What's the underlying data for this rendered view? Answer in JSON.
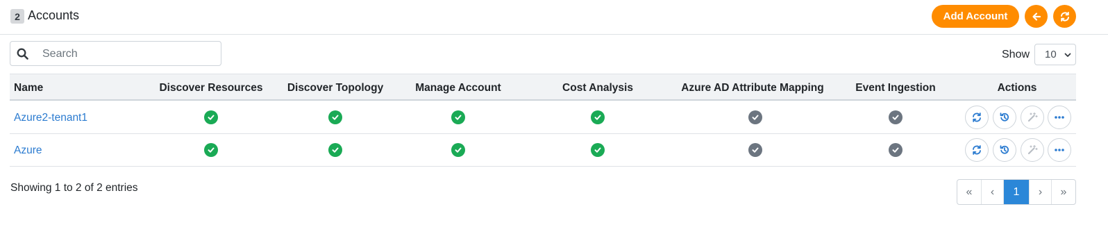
{
  "header": {
    "count": "2",
    "title": "Accounts",
    "add_label": "Add Account",
    "accent_color": "#ff8c00",
    "back_icon": "arrow-left-icon",
    "refresh_icon": "refresh-icon"
  },
  "search": {
    "placeholder": "Search",
    "value": ""
  },
  "show": {
    "label": "Show",
    "value": "10"
  },
  "table": {
    "columns": [
      "Name",
      "Discover Resources",
      "Discover Topology",
      "Manage Account",
      "Cost Analysis",
      "Azure AD Attribute Mapping",
      "Event Ingestion",
      "Actions"
    ],
    "rows": [
      {
        "name": "Azure2-tenant1",
        "discover_resources": "enabled",
        "discover_topology": "enabled",
        "manage_account": "enabled",
        "cost_analysis": "enabled",
        "azure_ad_mapping": "disabled",
        "event_ingestion": "disabled"
      },
      {
        "name": "Azure",
        "discover_resources": "enabled",
        "discover_topology": "enabled",
        "manage_account": "enabled",
        "cost_analysis": "enabled",
        "azure_ad_mapping": "disabled",
        "event_ingestion": "disabled"
      }
    ],
    "action_icons": [
      "sync-icon",
      "history-icon",
      "magic-wand-icon",
      "more-options-icon"
    ]
  },
  "footer": {
    "summary": "Showing 1 to 2 of 2 entries"
  },
  "pagination": {
    "first": "«",
    "prev": "‹",
    "current": "1",
    "next": "›",
    "last": "»"
  }
}
